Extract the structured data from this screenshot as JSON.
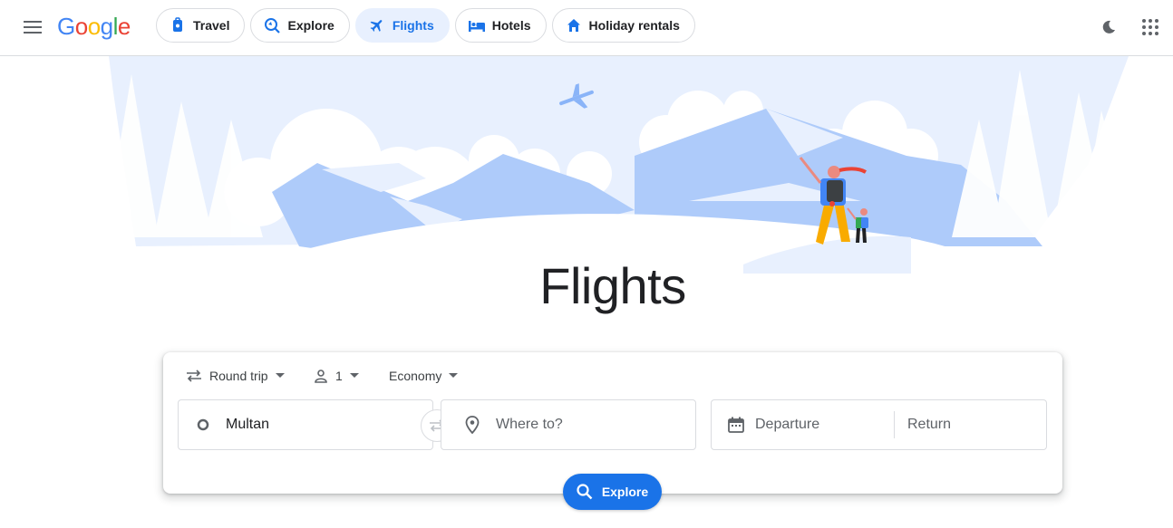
{
  "header": {
    "logo_text": "Google",
    "tabs": [
      {
        "label": "Travel",
        "icon": "travel-icon"
      },
      {
        "label": "Explore",
        "icon": "explore-icon"
      },
      {
        "label": "Flights",
        "icon": "flight-icon",
        "active": true
      },
      {
        "label": "Hotels",
        "icon": "hotel-icon"
      },
      {
        "label": "Holiday rentals",
        "icon": "home-icon"
      }
    ]
  },
  "hero": {
    "title": "Flights"
  },
  "search": {
    "trip_type": "Round trip",
    "passengers": "1",
    "cabin_class": "Economy",
    "origin_value": "Multan",
    "destination_placeholder": "Where to?",
    "departure_placeholder": "Departure",
    "return_placeholder": "Return",
    "explore_label": "Explore"
  },
  "colors": {
    "accent": "#1a73e8",
    "active_chip_bg": "#e8f0fe",
    "sky": "#e8f0fe",
    "mountain": "#aecbfa"
  }
}
